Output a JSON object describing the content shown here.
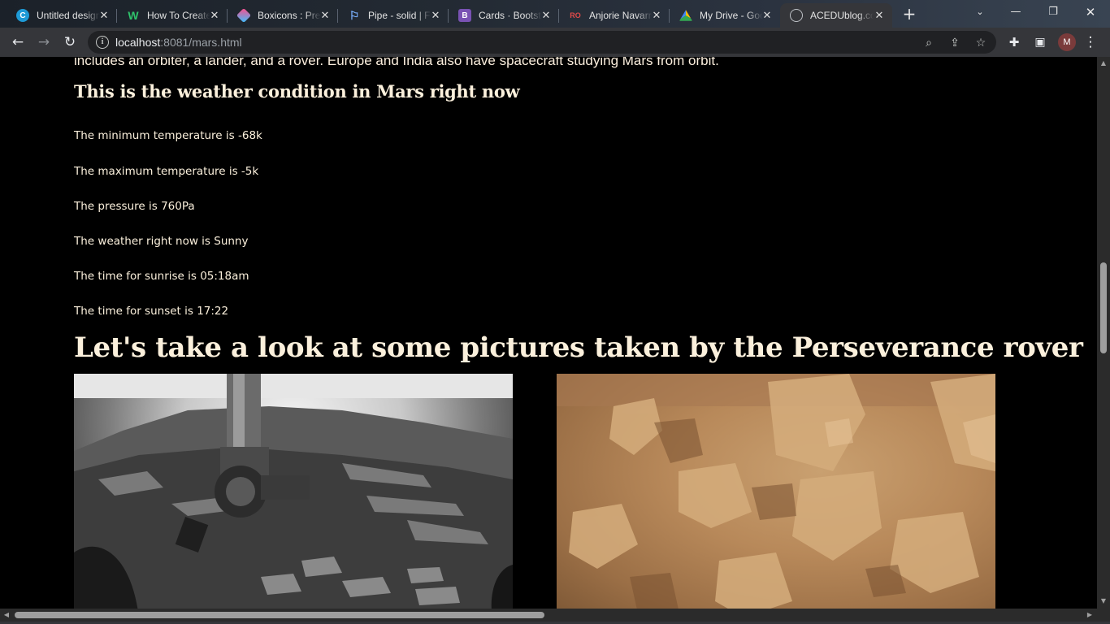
{
  "browser": {
    "tabs": [
      {
        "title": "Untitled design",
        "icon": "canva-icon",
        "color": "#7d2ae8",
        "letter": "C"
      },
      {
        "title": "How To Create",
        "icon": "webflow-icon",
        "color": "#0e8a55",
        "letter": "W"
      },
      {
        "title": "Boxicons : Premium",
        "icon": "boxicons-icon",
        "color": "#e74c8c",
        "letter": ""
      },
      {
        "title": "Pipe - solid | Font",
        "icon": "flag-icon",
        "color": "#6ea8ff",
        "letter": ""
      },
      {
        "title": "Cards · Bootstrap",
        "icon": "bootstrap-icon",
        "color": "#7952b3",
        "letter": "B"
      },
      {
        "title": "Anjorie Navarro",
        "icon": "ro-icon",
        "color": "#c0392b",
        "letter": "RO"
      },
      {
        "title": "My Drive - Google",
        "icon": "drive-icon",
        "color": "#34a853",
        "letter": ""
      },
      {
        "title": "ACEDUblog.com",
        "icon": "globe-icon",
        "color": "#9aa0a6",
        "letter": ""
      }
    ],
    "active_tab_index": 7,
    "url_host": "localhost",
    "url_path": ":8081/mars.html",
    "profile_initial": "M"
  },
  "page": {
    "intro_tail": "includes an orbiter, a lander, and a rover. Europe and India also have spacecraft studying Mars from orbit.",
    "weather_heading": "This is the weather condition in Mars right now",
    "weather": {
      "min_temp": "The minimum temperature is -68k",
      "max_temp": "The maximum temperature is -5k",
      "pressure": "The pressure is 760Pa",
      "condition": "The weather right now is Sunny",
      "sunrise": "The time for sunrise is 05:18am",
      "sunset": "The time for sunset is 17:22"
    },
    "pictures_heading": "Let's take a look at some pictures taken by the Perseverance rover",
    "photos": [
      {
        "name": "rover-arm-grayscale-photo"
      },
      {
        "name": "mars-rocks-color-photo"
      }
    ]
  }
}
